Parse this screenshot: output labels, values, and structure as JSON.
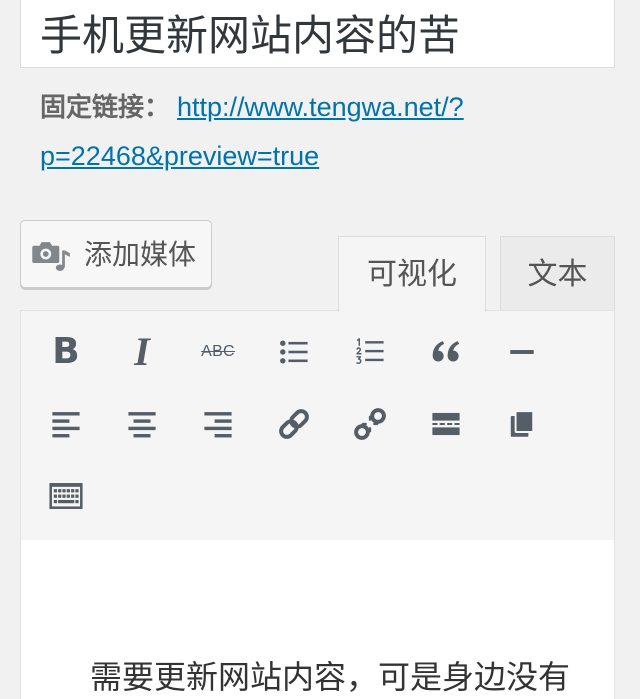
{
  "title": {
    "value": "手机更新网站内容的苦"
  },
  "permalink": {
    "label": "固定链接：",
    "url": "http://www.tengwa.net/?p=22468&preview=true"
  },
  "media_button": {
    "label": "添加媒体",
    "icon": "add-media-icon"
  },
  "tabs": {
    "visual": {
      "label": "可视化",
      "active": true
    },
    "text": {
      "label": "文本",
      "active": false
    }
  },
  "toolbar": {
    "rows": [
      [
        {
          "icon": "bold-icon",
          "glyph": "B"
        },
        {
          "icon": "italic-icon",
          "glyph": "I"
        },
        {
          "icon": "strikethrough-icon",
          "glyph": "ABC"
        },
        {
          "icon": "bulleted-list-icon"
        },
        {
          "icon": "numbered-list-icon"
        },
        {
          "icon": "blockquote-icon"
        },
        {
          "icon": "horizontal-line-icon"
        }
      ],
      [
        {
          "icon": "align-left-icon"
        },
        {
          "icon": "align-center-icon"
        },
        {
          "icon": "align-right-icon"
        },
        {
          "icon": "insert-link-icon"
        },
        {
          "icon": "remove-link-icon"
        },
        {
          "icon": "read-more-icon"
        },
        {
          "icon": "paste-icon"
        }
      ],
      [
        {
          "icon": "toolbar-toggle-icon"
        }
      ]
    ]
  },
  "content": {
    "paragraph": "需要更新网站内容，可是身边没有"
  },
  "colors": {
    "page_bg": "#f1f1f1",
    "link": "#0073aa",
    "icon": "#555d66",
    "toolbar_bg": "#f5f5f5",
    "text_tab_bg": "#ebebeb",
    "media_icon": "#82878c",
    "border": "#dddddd"
  }
}
